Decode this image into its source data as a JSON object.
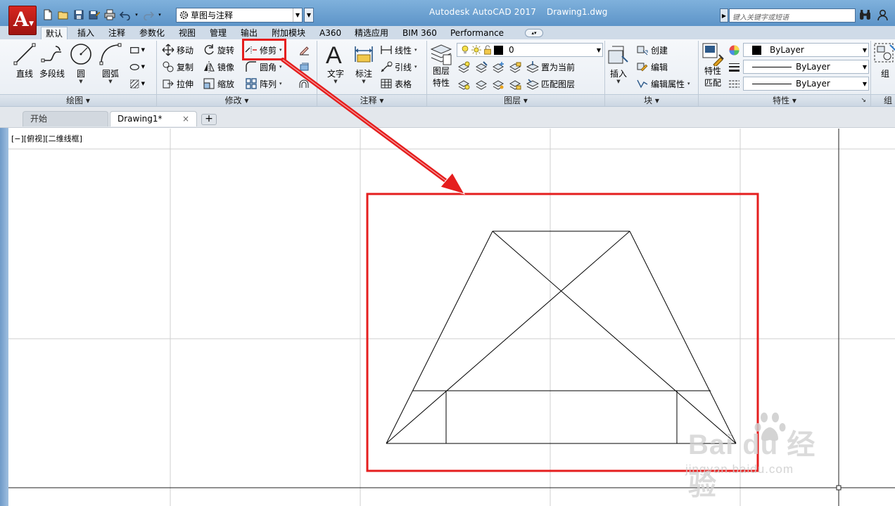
{
  "titlebar": {
    "workspace": "草图与注释",
    "app_title": "Autodesk AutoCAD 2017",
    "doc_title": "Drawing1.dwg",
    "search_placeholder": "键入关键字或短语"
  },
  "ribbon_tabs": [
    "默认",
    "插入",
    "注释",
    "参数化",
    "视图",
    "管理",
    "输出",
    "附加模块",
    "A360",
    "精选应用",
    "BIM 360",
    "Performance"
  ],
  "draw_panel": {
    "title": "绘图",
    "line": "直线",
    "polyline": "多段线",
    "circle": "圆",
    "arc": "圆弧"
  },
  "modify_panel": {
    "title": "修改",
    "move": "移动",
    "rotate": "旋转",
    "trim": "修剪",
    "copy": "复制",
    "mirror": "镜像",
    "fillet": "圆角",
    "stretch": "拉伸",
    "scale": "缩放",
    "array": "阵列"
  },
  "annotation_panel": {
    "title": "注释",
    "text": "文字",
    "dimension": "标注",
    "linear": "线性",
    "leader": "引线",
    "table": "表格"
  },
  "layers_panel": {
    "title": "图层",
    "layer_props": "图层\n特性",
    "layer_props_l1": "图层",
    "layer_props_l2": "特性",
    "current_layer": "0",
    "set_current": "置为当前",
    "match_layer": "匹配图层"
  },
  "block_panel": {
    "title": "块",
    "insert": "插入",
    "create": "创建",
    "edit": "编辑",
    "edit_attrs": "编辑属性"
  },
  "properties_panel": {
    "title": "特性",
    "match_l1": "特性",
    "match_l2": "匹配",
    "color": "ByLayer",
    "linetype": "ByLayer",
    "lineweight": "ByLayer"
  },
  "group_panel": {
    "title": "组",
    "group": "组"
  },
  "doc_tabs": {
    "start": "开始",
    "drawing": "Drawing1*",
    "close": "×",
    "new": "+"
  },
  "viewport": {
    "label": "[−][俯视][二维线框]"
  },
  "watermark": {
    "brand": "Bai du 经验",
    "url": "jingyan.baidu.com"
  },
  "colors": {
    "highlight": "#e51e1e",
    "title_bar": "#6c9fd0"
  }
}
